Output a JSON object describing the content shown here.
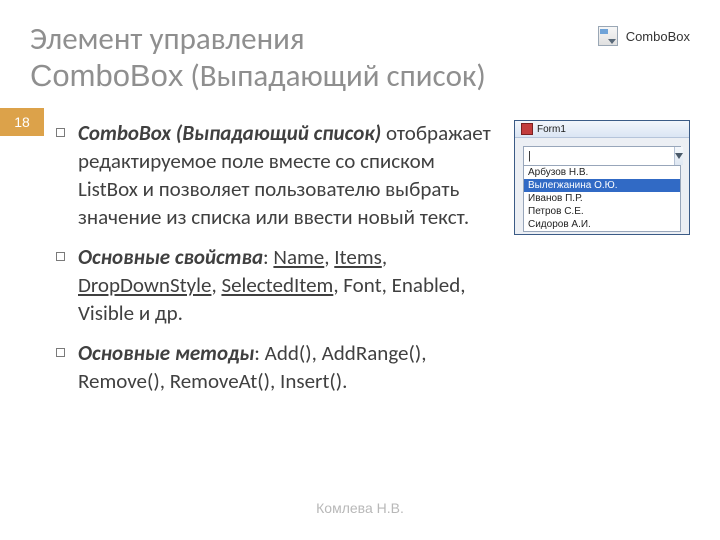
{
  "page_number": "18",
  "title_line1": "Элемент управления",
  "title_line2_brand": "ComboBox",
  "title_line2_paren": "(Выпадающий список)",
  "toolbox_label": "ComboBox",
  "bullets": {
    "b1_lead": "ComboBox (Выпадающий список)",
    "b1_rest": " отображает редактируемое поле вместе со списком ListBox и позволяет пользователю выбрать значение из списка или ввести новый текст.",
    "b2_lead": "Основные свойства",
    "b2_sep": ": ",
    "b2_p1": "Name",
    "b2_c1": ", ",
    "b2_p2": "Items",
    "b2_c2": ", ",
    "b2_p3": "DropDownStyle",
    "b2_c3": ", ",
    "b2_p4": "SelectedItem",
    "b2_rest": ", Font, Enabled, Visible и др.",
    "b3_lead": "Основные методы",
    "b3_rest": ": Add(), AddRange(), Remove(), RemoveAt(), Insert()."
  },
  "form": {
    "title": "Form1",
    "typed": "|",
    "items": [
      "Арбузов Н.В.",
      "Вылегжанина О.Ю.",
      "Иванов П.Р.",
      "Петров С.Е.",
      "Сидоров А.И."
    ],
    "selected_index": 1
  },
  "footer": "Комлева Н.В."
}
